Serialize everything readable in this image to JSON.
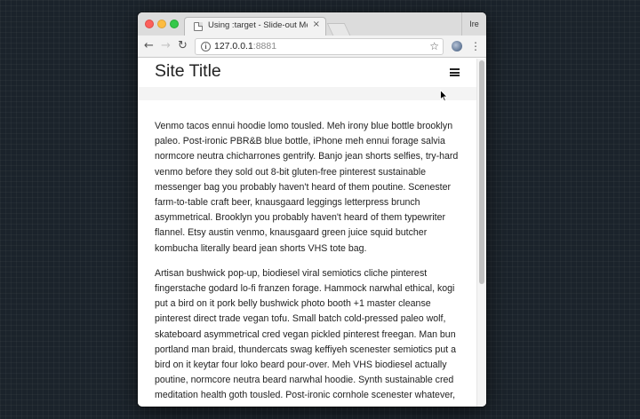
{
  "browser": {
    "tab_title": "Using :target - Slide-out Menu",
    "tab_close": "×",
    "profile_label": "Ire",
    "url_host": "127.0.0.1",
    "url_port": ":8881",
    "info_icon_glyph": "i",
    "back_icon": "←",
    "forward_icon": "→",
    "reload_icon": "↻",
    "star_icon": "☆",
    "menu_icon": "⋮"
  },
  "page": {
    "site_title": "Site Title",
    "menu_icon": "hamburger-icon",
    "paragraphs": [
      "Venmo tacos ennui hoodie lomo tousled. Meh irony blue bottle brooklyn paleo. Post-ironic PBR&B blue bottle, iPhone meh ennui forage salvia normcore neutra chicharrones gentrify. Banjo jean shorts selfies, try-hard venmo before they sold out 8-bit gluten-free pinterest sustainable messenger bag you probably haven't heard of them poutine. Scenester farm-to-table craft beer, knausgaard leggings letterpress brunch asymmetrical. Brooklyn you probably haven't heard of them typewriter flannel. Etsy austin venmo, knausgaard green juice squid butcher kombucha literally beard jean shorts VHS tote bag.",
      "Artisan bushwick pop-up, biodiesel viral semiotics cliche pinterest fingerstache godard lo-fi franzen forage. Hammock narwhal ethical, kogi put a bird on it pork belly bushwick photo booth +1 master cleanse pinterest direct trade vegan tofu. Small batch cold-pressed paleo wolf, skateboard asymmetrical cred vegan pickled pinterest freegan. Man bun portland man braid, thundercats swag keffiyeh scenester semiotics put a bird on it keytar four loko beard pour-over. Meh VHS biodiesel actually poutine, normcore neutra beard narwhal hoodie. Synth sustainable cred meditation health goth tousled. Post-ironic cornhole scenester whatever,"
    ]
  },
  "colors": {
    "desktop": "#1b232b",
    "traffic_red": "#fc605c",
    "traffic_yellow": "#fdbc40",
    "traffic_green": "#34c84a"
  }
}
